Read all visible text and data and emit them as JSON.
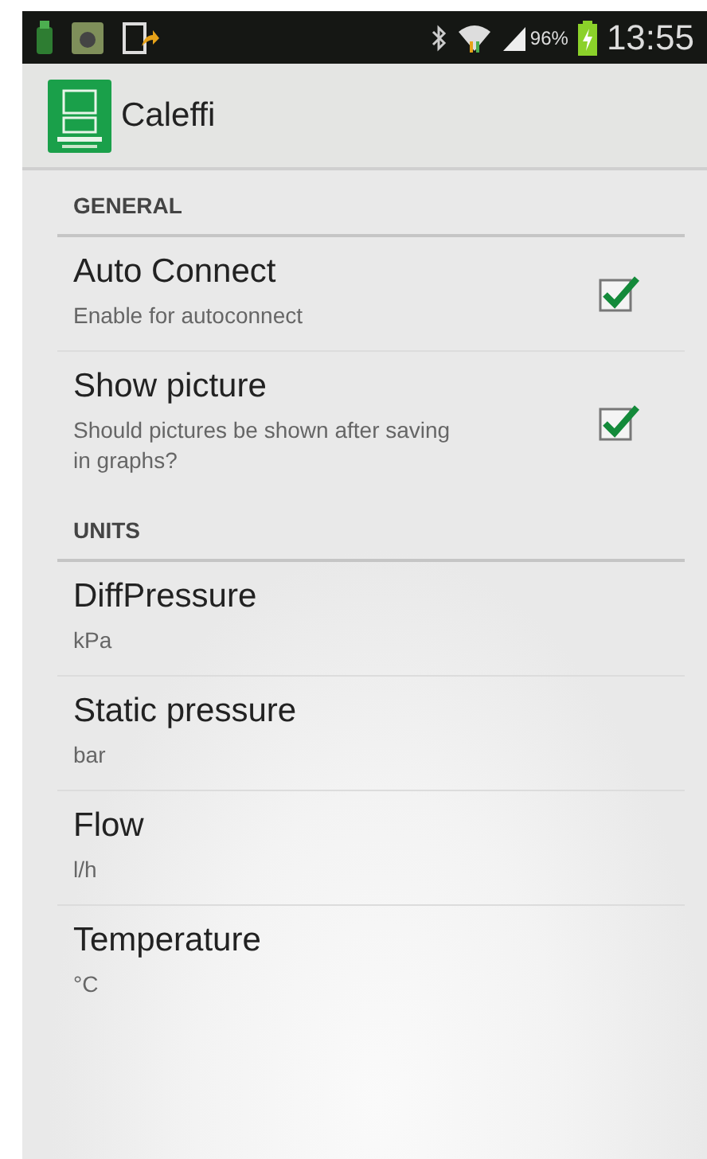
{
  "status_bar": {
    "battery_percent": "96%",
    "time": "13:55"
  },
  "action_bar": {
    "title": "Caleffi"
  },
  "sections": [
    {
      "header": "GENERAL",
      "items": [
        {
          "kind": "checkbox",
          "title": "Auto Connect",
          "summary": "Enable for autoconnect",
          "checked": true
        },
        {
          "kind": "checkbox",
          "title": "Show picture",
          "summary": "Should pictures be shown after saving in graphs?",
          "checked": true
        }
      ]
    },
    {
      "header": "UNITS",
      "items": [
        {
          "kind": "list",
          "title": "DiffPressure",
          "summary": "kPa"
        },
        {
          "kind": "list",
          "title": "Static pressure",
          "summary": "bar"
        },
        {
          "kind": "list",
          "title": "Flow",
          "summary": "l/h"
        },
        {
          "kind": "list",
          "title": "Temperature",
          "summary": "°C"
        }
      ]
    }
  ]
}
